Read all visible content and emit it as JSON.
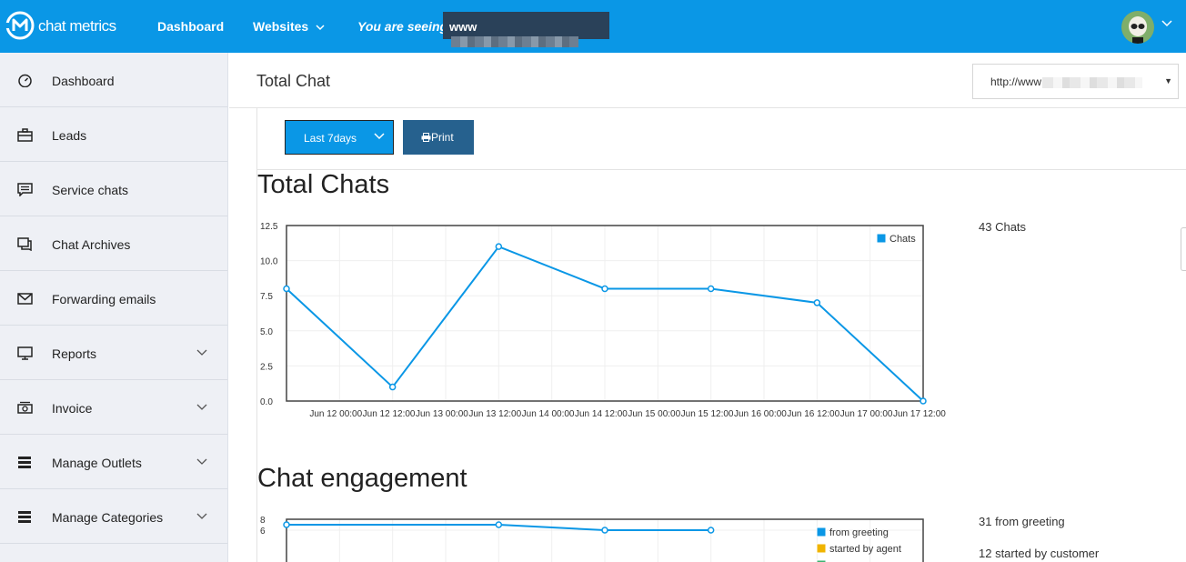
{
  "topbar": {
    "brand": "chat metrics",
    "nav_dashboard": "Dashboard",
    "nav_websites": "Websites",
    "seeing_label": "You are seeing:",
    "seeing_value": "www"
  },
  "sidebar": {
    "items": [
      {
        "label": "Dashboard",
        "icon": "dashboard-icon"
      },
      {
        "label": "Leads",
        "icon": "briefcase-icon"
      },
      {
        "label": "Service chats",
        "icon": "chat-message-icon"
      },
      {
        "label": "Chat Archives",
        "icon": "chat-archive-icon"
      },
      {
        "label": "Forwarding emails",
        "icon": "envelope-icon"
      },
      {
        "label": "Reports",
        "icon": "monitor-icon",
        "expandable": true
      },
      {
        "label": "Invoice",
        "icon": "money-icon",
        "expandable": true
      },
      {
        "label": "Manage Outlets",
        "icon": "list-icon",
        "expandable": true
      },
      {
        "label": "Manage Categories",
        "icon": "list-icon",
        "expandable": true
      }
    ]
  },
  "header": {
    "title": "Total Chat",
    "site_select_value": "http://www"
  },
  "toolbar": {
    "range_label": "Last 7days",
    "print_label": "Print"
  },
  "sections": {
    "total_chats_title": "Total Chats",
    "engagement_title": "Chat engagement"
  },
  "stats": {
    "total": "43 Chats",
    "from_greeting": "31 from greeting",
    "started_by_customer": "12 started by customer"
  },
  "colors": {
    "topbar": "#0a97e6",
    "series_blue": "#0a97e6",
    "series_yellow": "#f0b400",
    "series_green": "#3cb371",
    "print_button": "#26618e"
  },
  "chart_data": [
    {
      "type": "line",
      "title": "",
      "x": [
        "Jun 12 00:00",
        "Jun 12 12:00",
        "Jun 13 00:00",
        "Jun 13 12:00",
        "Jun 14 00:00",
        "Jun 14 12:00",
        "Jun 15 00:00",
        "Jun 15 12:00",
        "Jun 16 00:00",
        "Jun 16 12:00",
        "Jun 17 00:00",
        "Jun 17 12:00"
      ],
      "y_ticks": [
        "12.5",
        "10.0",
        "7.5",
        "5.0",
        "2.5",
        "0.0"
      ],
      "ylim": [
        0,
        12.5
      ],
      "legend_position": "top-right",
      "series": [
        {
          "name": "Chats",
          "color": "#0a97e6",
          "points": [
            [
              0,
              8
            ],
            [
              2,
              1
            ],
            [
              4,
              11
            ],
            [
              6,
              8
            ],
            [
              8,
              8
            ],
            [
              10,
              7
            ],
            [
              12,
              0
            ]
          ]
        }
      ]
    },
    {
      "type": "line",
      "title": "",
      "y_ticks": [
        "8",
        "6"
      ],
      "ylim": [
        0,
        8
      ],
      "legend_position": "top-right",
      "series": [
        {
          "name": "from greeting",
          "color": "#0a97e6",
          "points": [
            [
              0,
              7
            ],
            [
              4,
              7
            ],
            [
              6,
              6
            ],
            [
              8,
              6
            ]
          ]
        },
        {
          "name": "started by agent",
          "color": "#f0b400",
          "points": []
        },
        {
          "name": "",
          "color": "#3cb371",
          "points": []
        }
      ]
    }
  ]
}
